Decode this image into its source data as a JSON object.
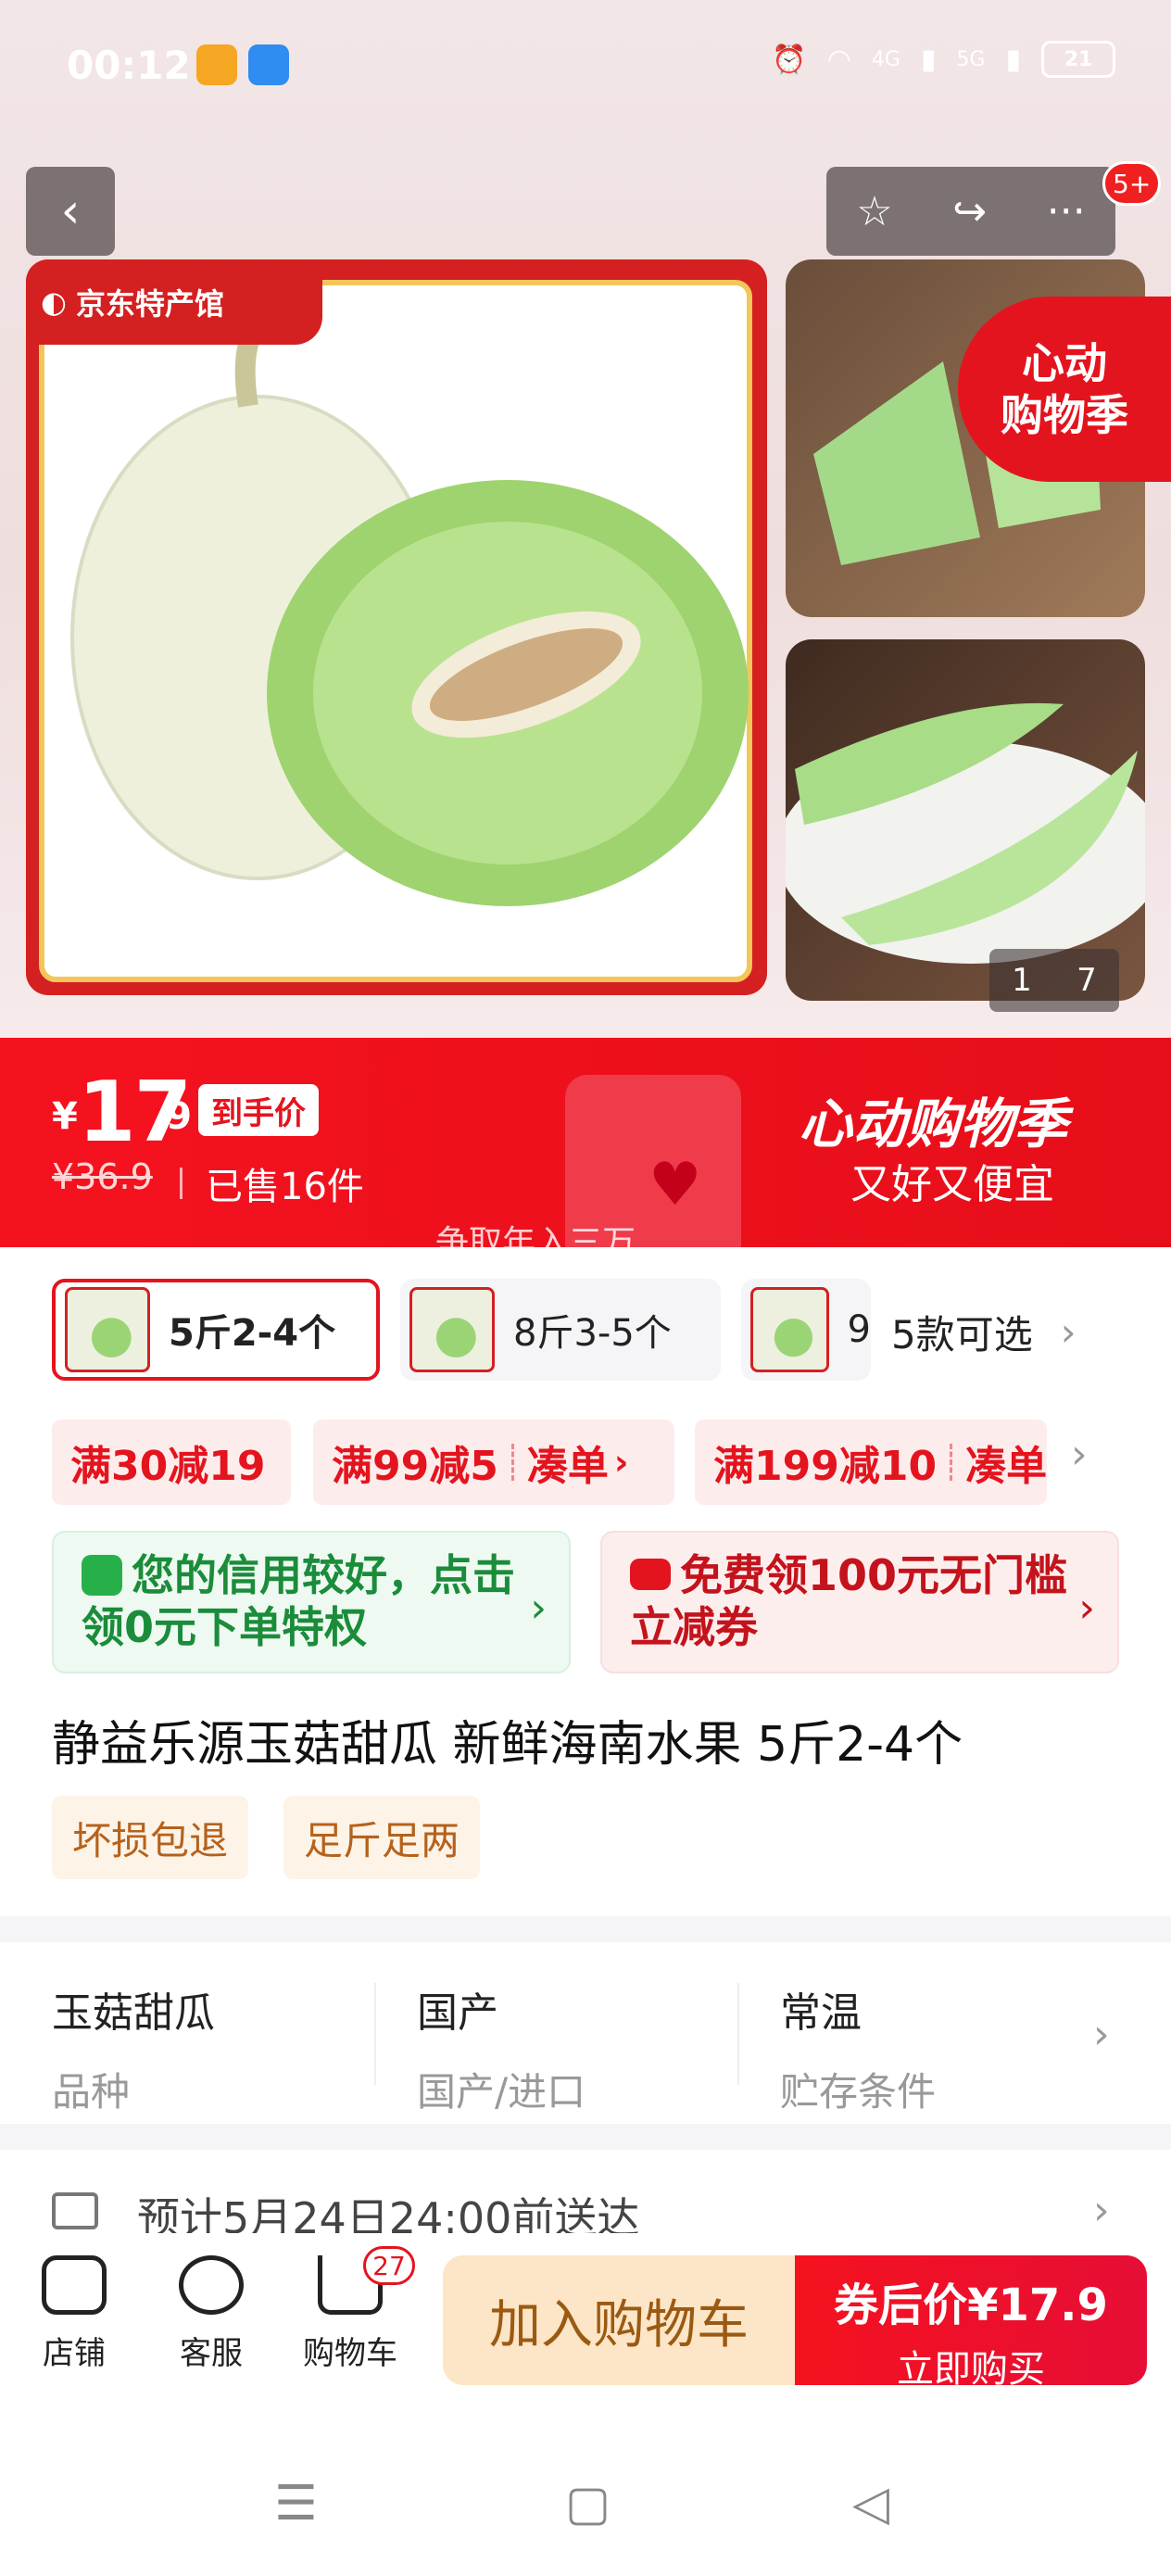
{
  "status_bar": {
    "time": "00:12",
    "network_4g": "4G",
    "network_5g": "5G",
    "battery": "21"
  },
  "header": {
    "back_icon": "‹",
    "favorite_icon": "☆",
    "share_icon": "↪",
    "more_icon": "···",
    "more_badge": "5+"
  },
  "gallery": {
    "store_tag": "京东特产馆",
    "promo_stamp": "心动\n购物季",
    "page_current": "1",
    "page_total": "7"
  },
  "price_banner": {
    "currency": "¥",
    "price_int": "17",
    "price_dec": ".9",
    "price_tag": "到手价",
    "original_price": "¥36.9",
    "sold": "已售16件",
    "title": "心动购物季",
    "subtitle": "又好又便宜",
    "scroll_text": "争取年入三万"
  },
  "variants": {
    "items": [
      {
        "label": "5斤2-4个",
        "selected": true
      },
      {
        "label": "8斤3-5个",
        "selected": false
      },
      {
        "label": "9",
        "selected": false
      }
    ],
    "more_label": "5款可选"
  },
  "coupons": [
    {
      "text": "满30减19"
    },
    {
      "text": "满99减5",
      "action": "凑单"
    },
    {
      "text": "满199减10",
      "action": "凑单"
    }
  ],
  "cards": {
    "credit": "您的信用较好，点击领0元下单特权",
    "voucher": "免费领100元无门槛立减券"
  },
  "product": {
    "title": "静益乐源玉菇甜瓜 新鲜海南水果 5斤2-4个",
    "tags": [
      "坏损包退",
      "足斤足两"
    ]
  },
  "specs": [
    {
      "value": "玉菇甜瓜",
      "label": "品种"
    },
    {
      "value": "国产",
      "label": "国产/进口"
    },
    {
      "value": "常温",
      "label": "贮存条件"
    }
  ],
  "delivery": {
    "text": "预计5月24日24:00前送达"
  },
  "action_bar": {
    "store": "店铺",
    "service": "客服",
    "cart": "购物车",
    "cart_count": "27",
    "add_to_cart": "加入购物车",
    "buy_price": "券后价¥17.9",
    "buy_now": "立即购买"
  },
  "colors": {
    "brand_red": "#e4141e",
    "add_cart_bg": "#fde5c7",
    "credit_green": "#1a8c3a"
  }
}
